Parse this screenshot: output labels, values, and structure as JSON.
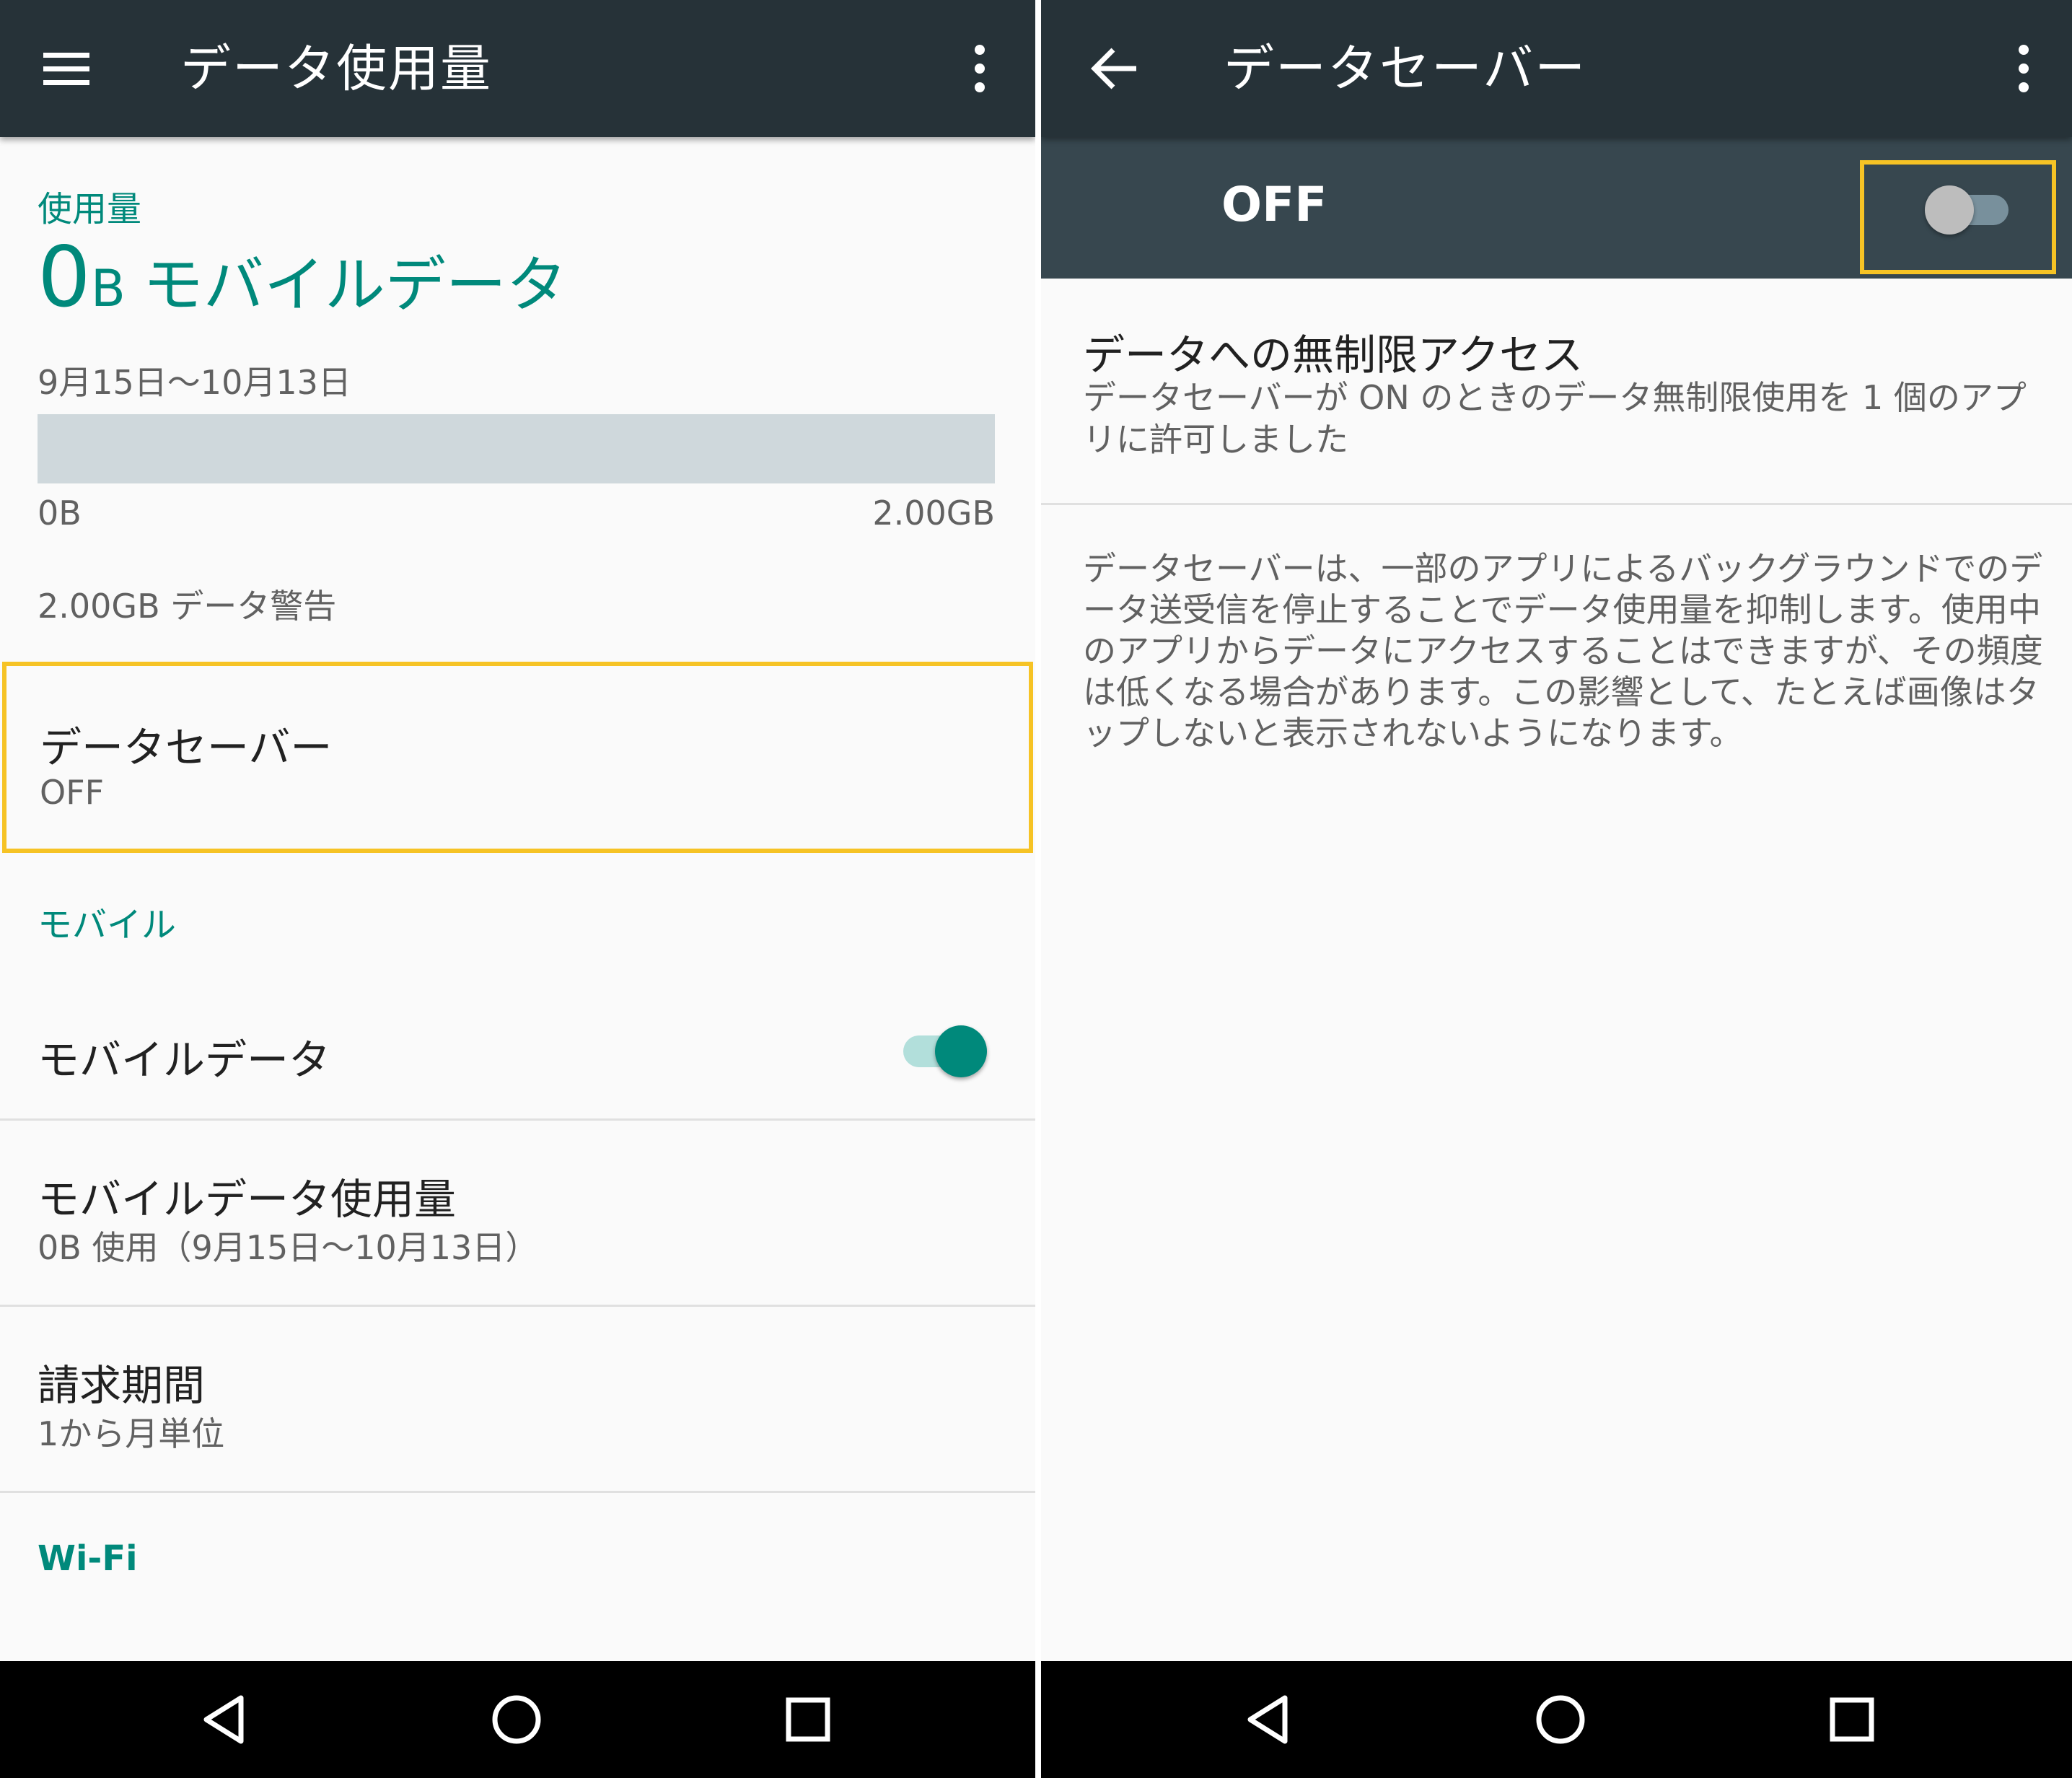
{
  "left": {
    "appbar": {
      "menu_icon": "hamburger-menu-icon",
      "title": "データ使用量",
      "overflow_icon": "more-vert-icon"
    },
    "usage": {
      "section_header": "使用量",
      "amount_number": "0",
      "amount_unit": "B",
      "amount_label": "モバイルデータ",
      "period": "9月15日〜10月13日",
      "bar_fraction": 0,
      "bar_min_label": "0B",
      "bar_max_label": "2.00GB",
      "warning": "2.00GB データ警告"
    },
    "data_saver_item": {
      "title": "データセーバー",
      "summary": "OFF"
    },
    "mobile_section": {
      "header": "モバイル",
      "mobile_data": {
        "title": "モバイルデータ",
        "toggle_on": true
      },
      "mobile_data_usage": {
        "title": "モバイルデータ使用量",
        "summary": "0B 使用（9月15日〜10月13日）"
      },
      "billing_cycle": {
        "title": "請求期間",
        "summary": "1から月単位"
      }
    },
    "wifi_section": {
      "header": "Wi-Fi"
    }
  },
  "right": {
    "appbar": {
      "back_icon": "arrow-back-icon",
      "title": "データセーバー",
      "overflow_icon": "more-vert-icon"
    },
    "master_switch": {
      "label": "OFF",
      "toggle_on": false
    },
    "unrestricted": {
      "title": "データへの無制限アクセス",
      "summary": "データセーバーが ON のときのデータ無制限使用を 1 個のアプリに許可しました"
    },
    "description": "データセーバーは、一部のアプリによるバックグラウンドでのデータ送受信を停止することでデータ使用量を抑制します。使用中のアプリからデータにアクセスすることはできますが、その頻度は低くなる場合があります。この影響として、たとえば画像はタップしないと表示されないようになります。"
  },
  "navbar": {
    "back_icon": "nav-back-triangle-icon",
    "home_icon": "nav-home-circle-icon",
    "recents_icon": "nav-recents-square-icon"
  },
  "colors": {
    "appbar": "#263238",
    "master_bar": "#37474f",
    "accent": "#00897b",
    "highlight": "#f6c325",
    "usage_bar": "#cfd8dc"
  }
}
